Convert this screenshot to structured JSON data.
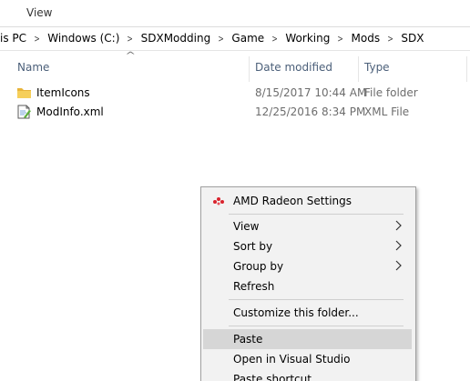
{
  "ribbon": {
    "view_tab": "View"
  },
  "address": {
    "crumbs": [
      "is PC",
      "Windows (C:)",
      "SDXModding",
      "Game",
      "Working",
      "Mods",
      "SDX"
    ]
  },
  "columns": {
    "name": "Name",
    "date": "Date modified",
    "type": "Type"
  },
  "files": [
    {
      "name": "ItemIcons",
      "date": "8/15/2017 10:44 AM",
      "type": "File folder",
      "icon": "folder-icon"
    },
    {
      "name": "ModInfo.xml",
      "date": "12/25/2016 8:34 PM",
      "type": "XML File",
      "icon": "xml-file-icon"
    }
  ],
  "context_menu": {
    "amd": "AMD Radeon Settings",
    "view": "View",
    "sort_by": "Sort by",
    "group_by": "Group by",
    "refresh": "Refresh",
    "customize": "Customize this folder...",
    "paste": "Paste",
    "open_vs": "Open in Visual Studio",
    "paste_shortcut": "Paste shortcut"
  },
  "colors": {
    "header_text": "#4c607a",
    "folder": "#f3c74d",
    "amd_red": "#d9232d",
    "highlight": "#d6d6d6"
  }
}
